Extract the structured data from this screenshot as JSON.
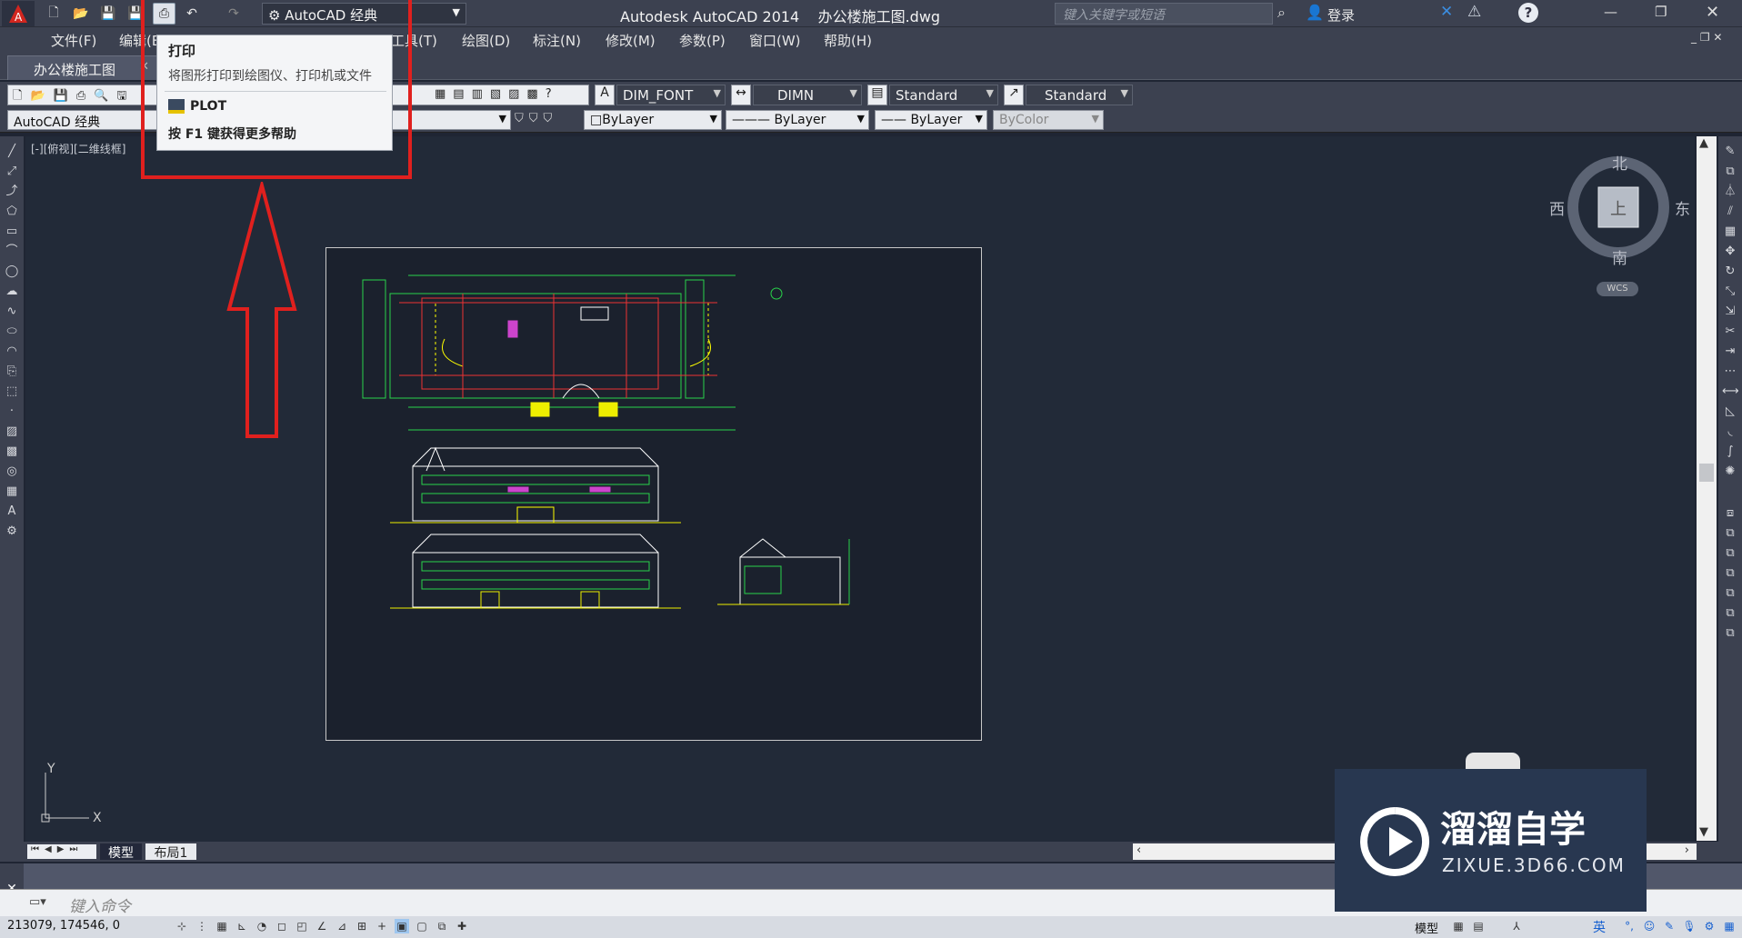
{
  "window": {
    "title": "Autodesk AutoCAD 2014    办公楼施工图.dwg",
    "workspace": "AutoCAD 经典",
    "search_placeholder": "键入关键字或短语",
    "login": "登录"
  },
  "menu": [
    "文件(F)",
    "编辑(E",
    "工具(T)",
    "绘图(D)",
    "标注(N)",
    "修改(M)",
    "参数(P)",
    "窗口(W)",
    "帮助(H)"
  ],
  "doc_tab": "办公楼施工图",
  "styles": {
    "text_style": "DIM_FONT",
    "dim_style": "DIMN",
    "table_style": "Standard",
    "mleader_style": "Standard"
  },
  "layers": {
    "workspace_combo": "AutoCAD 经典",
    "color": "ByLayer",
    "linetype": "ByLayer",
    "lineweight": "ByLayer",
    "plotstyle": "ByColor"
  },
  "tooltip": {
    "title": "打印",
    "desc": "将图形打印到绘图仪、打印机或文件",
    "command": "PLOT",
    "help": "按 F1 键获得更多帮助"
  },
  "viewport_label": "[-][俯视][二维线框]",
  "viewcube": {
    "north": "北",
    "south": "南",
    "west": "西",
    "east": "东",
    "top": "上",
    "wcs": "WCS"
  },
  "ucs": {
    "x": "X",
    "y": "Y"
  },
  "layout_tabs": [
    "模型",
    "布局1"
  ],
  "command_placeholder": "键入命令",
  "coords": "213079, 174546, 0",
  "status_model": "模型",
  "watermark": {
    "brand": "溜溜自学",
    "url": "ZIXUE.3D66.COM"
  },
  "ime": {
    "lang": "英"
  },
  "colors": {
    "accent_red": "#e0201e",
    "ui_dark": "#3c4150",
    "canvas": "#222a38"
  }
}
